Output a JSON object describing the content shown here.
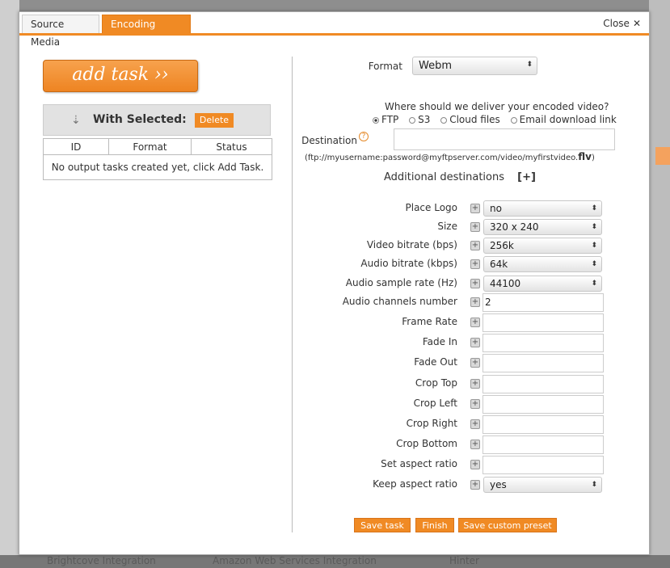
{
  "tabs": [
    {
      "label": "Source Media",
      "active": false
    },
    {
      "label": "Encoding Tasks",
      "active": true
    }
  ],
  "close_label": "Close",
  "add_task_label": "add task ››",
  "with_selected_label": "With Selected:",
  "delete_label": "Delete",
  "table": {
    "headers": [
      "ID",
      "Format",
      "Status"
    ],
    "empty_message": "No output tasks created yet, click Add Task."
  },
  "format": {
    "label": "Format",
    "value": "Webm"
  },
  "delivery": {
    "question": "Where should we deliver your encoded video?",
    "options": [
      "FTP",
      "S3",
      "Cloud files",
      "Email download link"
    ],
    "selected": "FTP",
    "destination_label": "Destination",
    "destination_value": "",
    "hint_prefix": "(ftp://myusername:password@myftpserver.com/video/myfirstvideo.",
    "hint_ext": "flv",
    "hint_suffix": ")"
  },
  "additional_destinations": {
    "label": "Additional destinations",
    "add_label": "[+]"
  },
  "settings": [
    {
      "label": "Place Logo",
      "type": "select",
      "value": "no"
    },
    {
      "label": "Size",
      "type": "select",
      "value": "320 x 240"
    },
    {
      "label": "Video bitrate (bps)",
      "type": "select",
      "value": "256k"
    },
    {
      "label": "Audio bitrate (kbps)",
      "type": "select",
      "value": "64k"
    },
    {
      "label": "Audio sample rate (Hz)",
      "type": "select",
      "value": "44100"
    },
    {
      "label": "Audio channels number",
      "type": "input",
      "value": "2"
    },
    {
      "label": "Frame Rate",
      "type": "input",
      "value": ""
    },
    {
      "label": "Fade In",
      "type": "input",
      "value": ""
    },
    {
      "label": "Fade Out",
      "type": "input",
      "value": ""
    },
    {
      "label": "Crop Top",
      "type": "input",
      "value": ""
    },
    {
      "label": "Crop Left",
      "type": "input",
      "value": ""
    },
    {
      "label": "Crop Right",
      "type": "input",
      "value": ""
    },
    {
      "label": "Crop Bottom",
      "type": "input",
      "value": ""
    },
    {
      "label": "Set aspect ratio",
      "type": "input",
      "value": ""
    },
    {
      "label": "Keep aspect ratio",
      "type": "select",
      "value": "yes"
    }
  ],
  "buttons": {
    "save_task": "Save task",
    "finish": "Finish",
    "save_preset": "Save custom preset"
  },
  "background": {
    "bottom_texts": [
      "Brightcove Integration",
      "Amazon Web Services Integration",
      "Hinter"
    ]
  },
  "colors": {
    "accent": "#f08a24",
    "overlay": "#8e8e8e"
  },
  "icons": {
    "close": "close-icon",
    "down_arrow": "down-arrow-icon",
    "help": "help-icon",
    "plus": "plus-icon",
    "select_arrow": "chevron-up-down-icon"
  }
}
